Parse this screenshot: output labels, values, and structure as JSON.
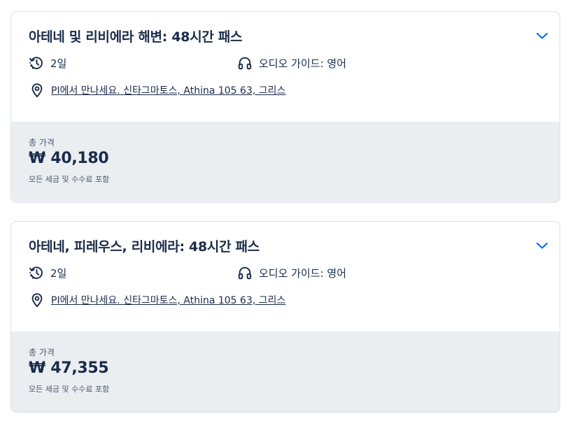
{
  "tours": [
    {
      "title": "아테네 및 리비에라 해변: 48시간 패스",
      "duration": "2일",
      "audio_guide": "오디오 가이드: 영어",
      "meeting_point": "PI에서 만나세요. 신타그마토스, Athina 105 63, 그리스",
      "price_label": "총 가격",
      "price": "₩ 40,180",
      "tax_note": "모든 세금 및 수수료 포함"
    },
    {
      "title": "아테네, 피레우스, 리비에라: 48시간 패스",
      "duration": "2일",
      "audio_guide": "오디오 가이드: 영어",
      "meeting_point": "PI에서 만나세요. 신타그마토스, Athina 105 63, 그리스",
      "price_label": "총 가격",
      "price": "₩ 47,355",
      "tax_note": "모든 세금 및 수수료 포함"
    }
  ],
  "icons": {
    "duration": "clock-history-icon",
    "audio": "headphones-icon",
    "location": "map-pin-icon",
    "expand": "chevron-down-icon"
  },
  "colors": {
    "text": "#1a2b49",
    "accent": "#0071eb",
    "price_bg": "#ebeef1",
    "border": "#dcdfe4"
  }
}
